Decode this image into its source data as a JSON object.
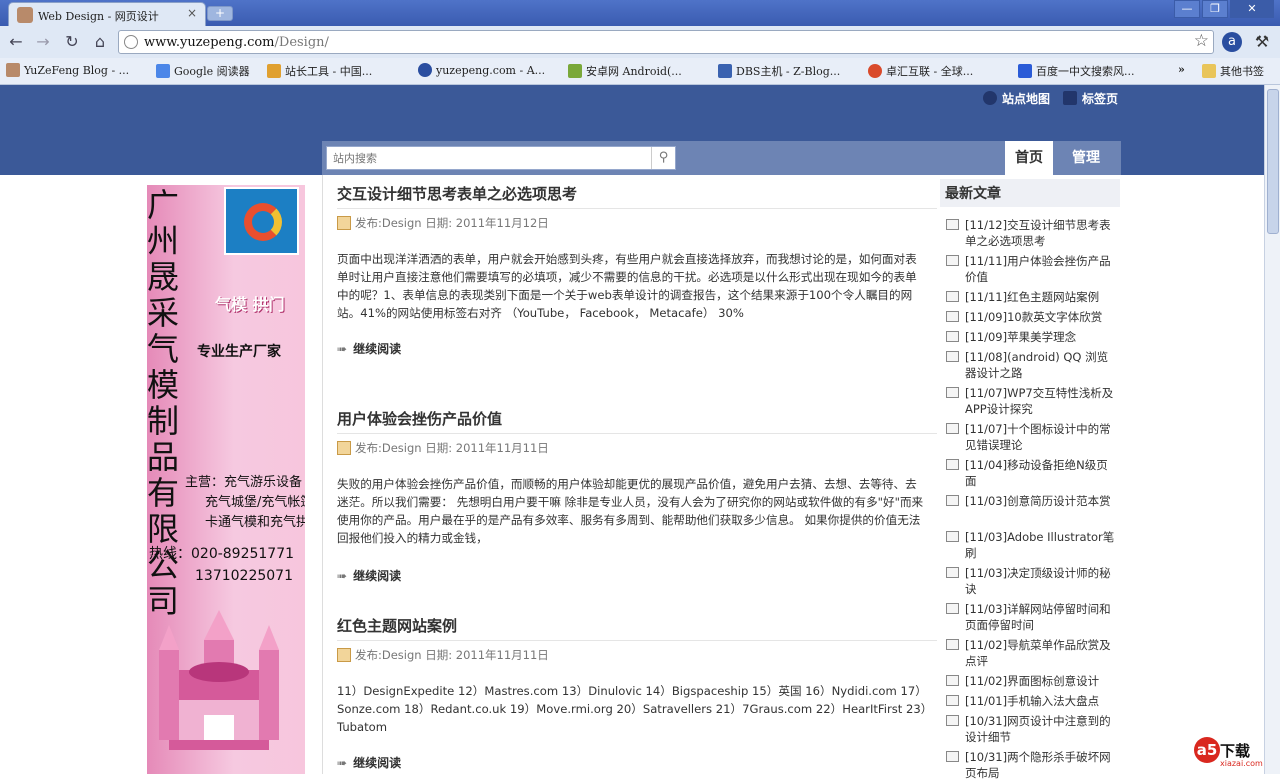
{
  "browser": {
    "tab_title": "Web Design - 网页设计",
    "tab_close": "×",
    "new_tab": "+",
    "url_host": "www.yuzepeng.com",
    "url_path": "/Design/",
    "window_buttons": [
      "—",
      "❐",
      "✕"
    ],
    "bookmarks": [
      {
        "label": "YuZeFeng Blog - ...",
        "icon": "avatar-icon",
        "color": "#b88a6a"
      },
      {
        "label": "Google 阅读器",
        "icon": "google-reader-icon",
        "color": "#4b86e8"
      },
      {
        "label": "站长工具 - 中国...",
        "icon": "chart-icon",
        "color": "#e0a030"
      },
      {
        "label": "yuzepeng.com - A...",
        "icon": "globe-icon",
        "color": "#2a4ea0"
      },
      {
        "label": "安卓网 Android(...",
        "icon": "android-icon",
        "color": "#7aa83a"
      },
      {
        "label": "DBS主机 - Z-Blog...",
        "icon": "shield-icon",
        "color": "#3a62b0"
      },
      {
        "label": "卓汇互联 - 全球...",
        "icon": "chrome-icon",
        "color": "#d94a2b"
      },
      {
        "label": "百度一中文搜索风...",
        "icon": "baidu-paw-icon",
        "color": "#2a5bd7"
      }
    ],
    "bookmarks_overflow": "»",
    "other_bookmarks": "其他书签"
  },
  "header": {
    "sitemap": "站点地图",
    "tags": "标签页"
  },
  "nav": {
    "search_placeholder": "站内搜索",
    "home": "首页",
    "admin": "管理"
  },
  "ad": {
    "company_vertical": "广州晟采气模制品有限公司",
    "slogan": "气模 拱门",
    "tagline": "专业生产厂家",
    "products": [
      "主营：充气游乐设备",
      "充气城堡/充气帐篷",
      "卡通气模和充气拱门"
    ],
    "hotline": "热线：020-89251771",
    "mobile": "13710225071"
  },
  "posts": [
    {
      "title": "交互设计细节思考表单之必选项思考",
      "meta": "发布:Design 日期: 2011年11月12日",
      "excerpt": "页面中出现洋洋洒洒的表单，用户就会开始感到头疼，有些用户就会直接选择放弃，而我想讨论的是，如何面对表单时让用户直接注意他们需要填写的必填项，减少不需要的信息的干扰。必选项是以什么形式出现在现如今的表单中的呢？1、表单信息的表现类别下面是一个关于web表单设计的调查报告，这个结果来源于100个令人瞩目的网站。41%的网站使用标签右对齐 （YouTube， Facebook， Metacafe） 30%",
      "more": "继续阅读"
    },
    {
      "title": "用户体验会挫伤产品价值",
      "meta": "发布:Design 日期: 2011年11月11日",
      "excerpt": "失败的用户体验会挫伤产品价值，而顺畅的用户体验却能更优的展现产品价值，避免用户去猜、去想、去等待、去迷茫。所以我们需要： 先想明白用户要干嘛 除非是专业人员，没有人会为了研究你的网站或软件做的有多\"好\"而来使用你的产品。用户最在乎的是产品有多效率、服务有多周到、能帮助他们获取多少信息。 如果你提供的价值无法回报他们投入的精力或金钱，",
      "more": "继续阅读"
    },
    {
      "title": "红色主题网站案例",
      "meta": "发布:Design 日期: 2011年11月11日",
      "excerpt": "11）DesignExpedite 12）Mastres.com 13）Dinulovic 14）Bigspaceship 15）英国 16）Nydidi.com 17）Sonze.com 18）Redant.co.uk 19）Move.rmi.org 20）Satravellers 21）7Graus.com 22）HearItFirst 23）Tubatom",
      "more": "继续阅读"
    }
  ],
  "sidebar": {
    "title": "最新文章",
    "items": [
      "[11/12]交互设计细节思考表单之必选项思考",
      "[11/11]用户体验会挫伤产品价值",
      "[11/11]红色主题网站案例",
      "[11/09]10款英文字体欣赏",
      "[11/09]苹果美学理念",
      "[11/08](android) QQ 浏览器设计之路",
      "[11/07]WP7交互特性浅析及APP设计探究",
      "[11/07]十个图标设计中的常见错误理论",
      "[11/04]移动设备拒绝N级页面",
      "[11/03]创意简历设计范本赏",
      "[11/03]Adobe Illustrator笔刷",
      "[11/03]决定顶级设计师的秘诀",
      "[11/03]详解网站停留时间和页面停留时间",
      "[11/02]导航菜单作品欣赏及点评",
      "[11/02]界面图标创意设计",
      "[11/01]手机输入法大盘点",
      "[10/31]网页设计中注意到的设计细节",
      "[10/31]两个隐形杀手破坏网页布局"
    ]
  },
  "watermark": {
    "badge": "a5",
    "text": "下载",
    "url": "xiazai.com"
  }
}
